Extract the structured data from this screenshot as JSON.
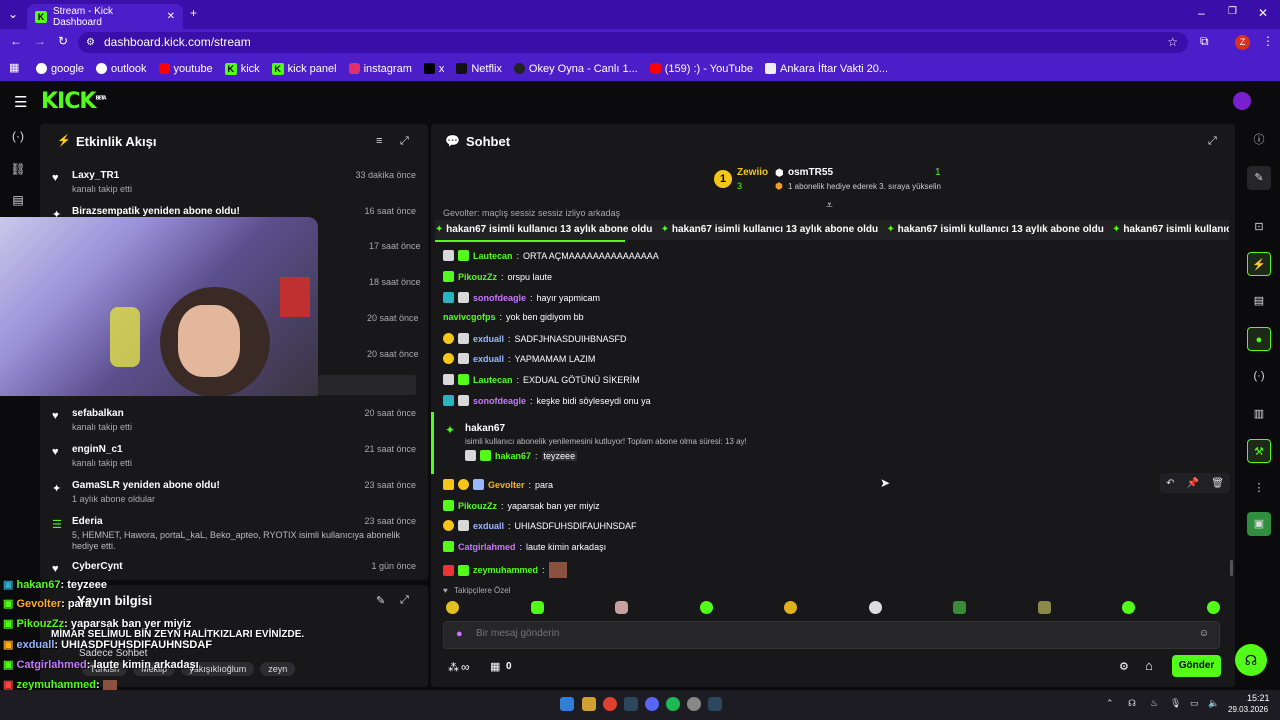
{
  "browser": {
    "tab_title": "Stream - Kick Dashboard",
    "url": "dashboard.kick.com/stream",
    "bookmarks": [
      "google",
      "outlook",
      "youtube",
      "kick",
      "kick panel",
      "instagram",
      "x",
      "Netflix",
      "Okey Oyna - Canlı 1...",
      "(159) :) - YouTube",
      "Ankara İftar Vakti 20..."
    ],
    "profile_initial": "Z"
  },
  "kick": {
    "logo": "KICK",
    "logo_beta": "BETA"
  },
  "activity": {
    "title": "Etkinlik Akışı",
    "items": [
      {
        "name": "Laxy_TR1",
        "sub": "kanalı takip etti",
        "time": "33 dakika önce",
        "icon": "heart"
      },
      {
        "name": "Birazsempatik yeniden abone oldu!",
        "sub": "",
        "time": "16 saat önce",
        "icon": "star"
      },
      {
        "name": "",
        "sub": "",
        "time": "17 saat önce",
        "icon": ""
      },
      {
        "name": "",
        "sub": "",
        "time": "18 saat önce",
        "icon": ""
      },
      {
        "name": "",
        "sub": "",
        "time": "20 saat önce",
        "icon": ""
      },
      {
        "name": "",
        "sub": "",
        "time": "20 saat önce",
        "icon": ""
      },
      {
        "name": "sefabalkan",
        "sub": "kanalı takip etti",
        "time": "20 saat önce",
        "icon": "heart"
      },
      {
        "name": "enginN_c1",
        "sub": "kanalı takip etti",
        "time": "21 saat önce",
        "icon": "heart"
      },
      {
        "name": "GamaSLR yeniden abone oldu!",
        "sub": "1 aylık abone oldular",
        "time": "23 saat önce",
        "icon": "star"
      },
      {
        "name": "Ederia",
        "sub": "5, HEMNET, Hawora, portaL_kaL, Beko_apteo, RYOTIX isimli kullanıcıya abonelik hediye etti.",
        "time": "23 saat önce",
        "icon": "gift"
      },
      {
        "name": "CyberCynt",
        "sub": "",
        "time": "1 gün önce",
        "icon": "heart"
      }
    ]
  },
  "stream_info": {
    "title": "Yayın bilgisi",
    "chat_mode": "Sadece Sohbet",
    "tags": [
      "Turkish",
      "Meklip",
      "yakışıklıoğlum",
      "zeyn"
    ]
  },
  "chat": {
    "title": "Sohbet",
    "leaderboard": {
      "rank": "1",
      "user1": "Zewiio",
      "user1_count": "3",
      "user2": "osmTR55",
      "user2_note": "1 abonelik hediye ederek 3. sıraya yükselin",
      "count": "1"
    },
    "partial_top": "Gevolter: maçlış sessiz sessiz izliyo arkadaş",
    "ticker": "hakan67 isimli kullanıcı 13 aylık abone oldu",
    "messages": [
      {
        "user": "Lautecan",
        "color": "#53fc18",
        "text": "ORTA AÇMAAAAAAAAAAAAAAA"
      },
      {
        "user": "PikouzZz",
        "color": "#53fc18",
        "text": "orspu laute"
      },
      {
        "user": "sonofdeagle",
        "color": "#c778ff",
        "text": "hayır yapmicam"
      },
      {
        "user": "navivcgofps",
        "color": "#53fc18",
        "text": "yok ben gidiyom bb"
      },
      {
        "user": "exduall",
        "color": "#9ab6ff",
        "text": "SADFJHNASDUIHBNASFD"
      },
      {
        "user": "exduall",
        "color": "#9ab6ff",
        "text": "YAPMAMAM LAZIM"
      },
      {
        "user": "Lautecan",
        "color": "#53fc18",
        "text": "EXDUAL GÖTÜNÜ SİKERİM"
      },
      {
        "user": "sonofdeagle",
        "color": "#c778ff",
        "text": "keşke bidi söyleseydi onu ya"
      }
    ],
    "sub_notice": {
      "user": "hakan67",
      "text": "isimli kullanıcı abonelik yenilemesini kutluyor! Toplam abone olma süresi: 13 ay!",
      "reply_user": "hakan67",
      "reply_text": "teyzeee"
    },
    "messages2": [
      {
        "user": "Gevolter",
        "color": "#ffb01f",
        "text": "para"
      },
      {
        "user": "PikouzZz",
        "color": "#53fc18",
        "text": "yaparsak ban yer miyiz"
      },
      {
        "user": "exduall",
        "color": "#9ab6ff",
        "text": "UHIASDFUHSDIFAUHNSDAF"
      },
      {
        "user": "Catgirlahmed",
        "color": "#c778ff",
        "text": "laute kimin arkadaşı"
      },
      {
        "user": "zeymuhammed",
        "color": "#53fc18",
        "text": ""
      }
    ],
    "followers_only": "Takipçilere Özel",
    "input_placeholder": "Bir mesaj gönderin",
    "infinity": "∞",
    "points": "0",
    "send": "Gönder"
  },
  "overlay_chat": [
    {
      "user": "hakan67",
      "color": "#53fc18",
      "text": ": teyzeee"
    },
    {
      "user": "Gevolter",
      "color": "#ffb01f",
      "text": ": para"
    },
    {
      "user": "PikouzZz",
      "color": "#53fc18",
      "text": ": yaparsak ban yer miyiz"
    },
    {
      "user": "",
      "color": "#fff",
      "text": "MİMAR SELİMUL BİN ZEYN HALİTKIZLARI EVİNİZDE."
    },
    {
      "user": "exduall",
      "color": "#9ab6ff",
      "text": ": UHIASDFUHSDIFAUHNSDAF"
    },
    {
      "user": "Catgirlahmed",
      "color": "#c778ff",
      "text": ": laute kimin arkadaşı"
    },
    {
      "user": "zeymuhammed",
      "color": "#53fc18",
      "text": ":"
    }
  ],
  "taskbar": {
    "time": "15:21",
    "date": "29.03.2026"
  },
  "colors": {
    "accent": "#53fc18",
    "chrome": "#4c1ec9",
    "panel": "#18181b"
  }
}
